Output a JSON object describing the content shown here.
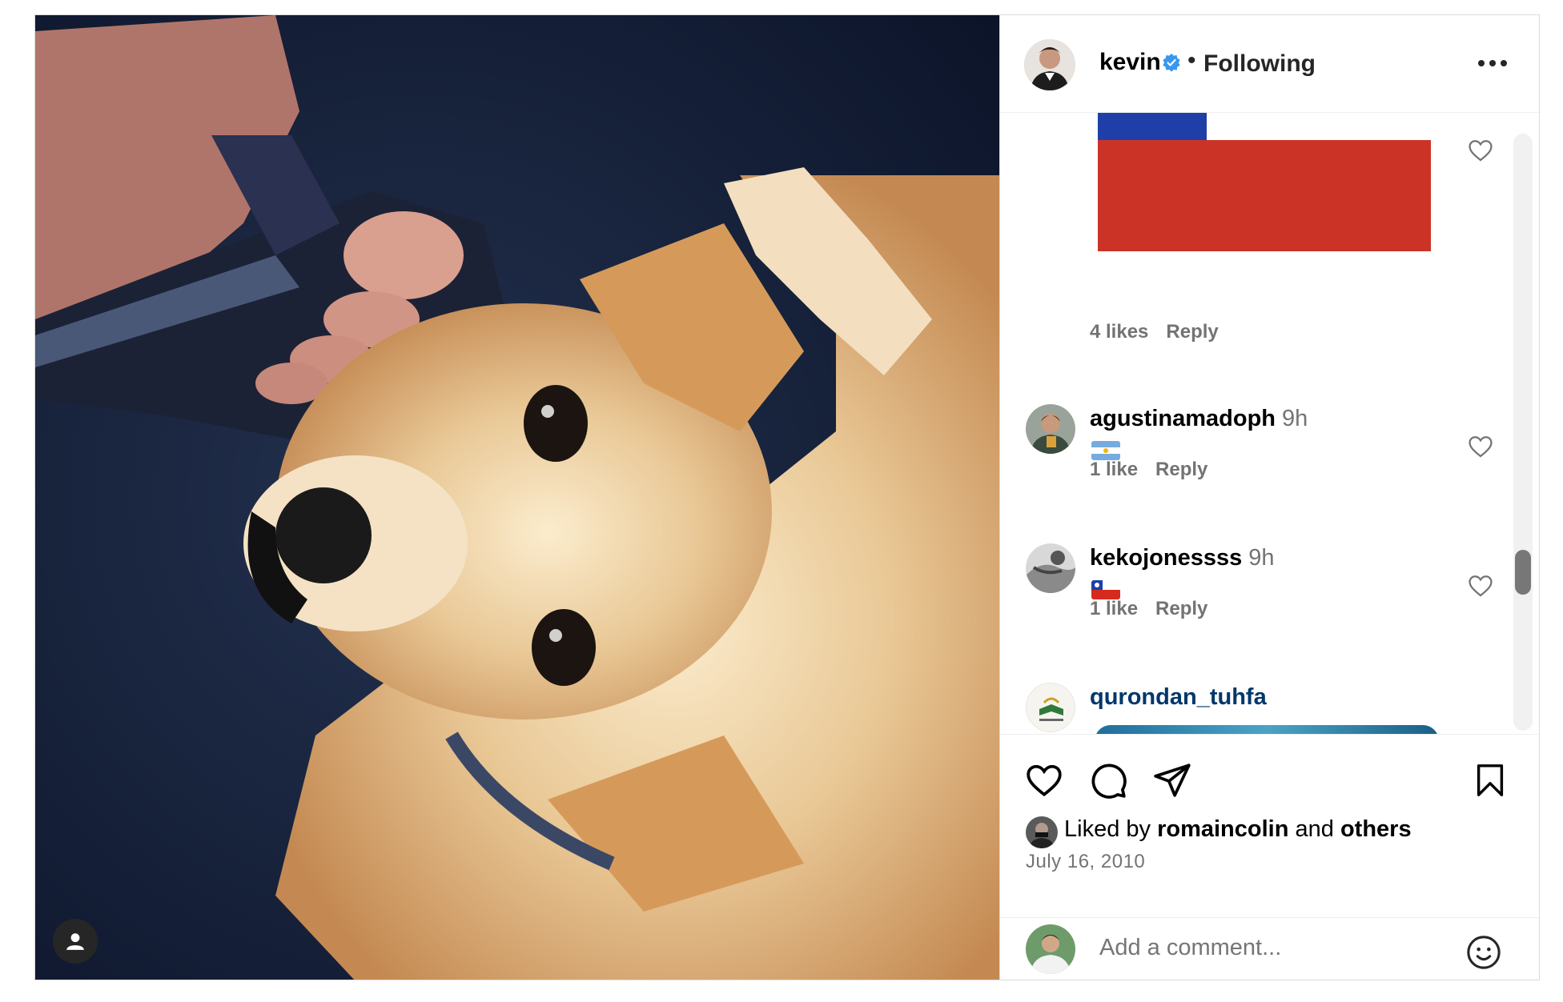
{
  "header": {
    "username": "kevin",
    "follow_status": "Following",
    "separator": "•"
  },
  "comments": [
    {
      "likes": "4 likes",
      "reply": "Reply"
    },
    {
      "username": "agustinamadoph",
      "time": "9h",
      "flag": "Argentina",
      "likes": "1 like",
      "reply": "Reply"
    },
    {
      "username": "kekojonessss",
      "time": "9h",
      "flag": "Chile",
      "likes": "1 like",
      "reply": "Reply"
    },
    {
      "username": "qurondan_tuhfa"
    }
  ],
  "liked_by": {
    "prefix": "Liked by",
    "user": "romaincolin",
    "conj": "and",
    "others": "others"
  },
  "date": "July 16, 2010",
  "comment_input": {
    "placeholder": "Add a comment..."
  },
  "colors": {
    "verified": "#3897f0",
    "link": "#00376b",
    "chile_red": "#cc3327",
    "chile_blue": "#1e3fa8"
  },
  "icons": [
    "verified-badge-icon",
    "more-options-icon",
    "heart-icon",
    "comment-icon",
    "share-icon",
    "bookmark-icon",
    "emoji-icon",
    "user-tag-icon"
  ]
}
